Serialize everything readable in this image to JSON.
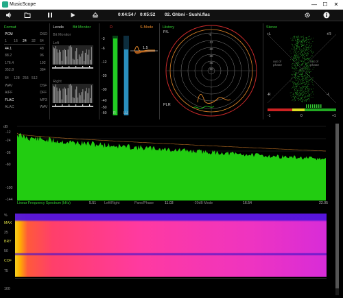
{
  "window": {
    "title": "MusicScope",
    "minimize": "—",
    "maximize": "☐",
    "close": "✕"
  },
  "toolbar": {
    "current_time": "0:04:54",
    "separator": "/",
    "total_time": "0:05:52",
    "track": "02. Ghbni - Sushi.flac"
  },
  "format": {
    "title": "Format",
    "rows": [
      [
        "PCM",
        "",
        "",
        "",
        "DSD"
      ],
      [
        "1",
        "16",
        "24",
        "32",
        "64"
      ],
      [
        "44.1",
        "",
        "",
        "",
        "48"
      ],
      [
        "88.2",
        "",
        "",
        "",
        "96"
      ],
      [
        "176.4",
        "",
        "",
        "",
        "192"
      ],
      [
        "352.8",
        "",
        "",
        "",
        "384"
      ],
      [
        "64",
        "128",
        "256",
        "512",
        ""
      ],
      [
        "WAV",
        "",
        "",
        "",
        "DSF"
      ],
      [
        "AIFF",
        "",
        "",
        "",
        "DFF"
      ],
      [
        "FLAC",
        "",
        "",
        "",
        "MP3"
      ],
      [
        "ALAC",
        "",
        "",
        "",
        "WAV"
      ]
    ]
  },
  "levels": {
    "title": "Levels",
    "bit_monitor": "Bit Monitor",
    "sub_bit_monitor": "Bit Monitor",
    "left": "Left",
    "right": "Right",
    "scale": [
      "-3",
      "-6",
      "-12",
      "-20",
      "-30",
      "-40",
      "-50",
      "-60"
    ],
    "mode_label": "S-Mode",
    "d_label": "D",
    "r_value": "1.5",
    "bar_labels": [
      "R",
      "LU"
    ]
  },
  "history": {
    "title": "History",
    "pl_label": "P/L",
    "plr_label": "PLR",
    "rings": [
      "-6",
      "-12",
      "-20",
      "-30",
      "-40",
      "-50"
    ]
  },
  "stereo": {
    "title": "Stereo",
    "plus_l": "+L",
    "plus_r": "+R",
    "minus_l": "-R",
    "minus_r": "-L",
    "out_phase_left": "out of phase",
    "out_phase_right": "out of phase",
    "corr_values": [
      "-1",
      "0",
      "+1"
    ]
  },
  "spectrum": {
    "label": "Linear Frequency Spectrum (kHz)",
    "db_label": "dB",
    "yticks": [
      "-12",
      "-24",
      "-36",
      "-60",
      "-100",
      "-144"
    ],
    "xticks": [
      "5.51",
      "11.03",
      "16.54",
      "22.05"
    ],
    "modes": [
      "Left/Right",
      "Pans/Phase",
      "-20dB Mode"
    ]
  },
  "spectrogram": {
    "yticks": [
      "%",
      "MAX",
      "25",
      "BRY",
      "50",
      "COF",
      "75",
      "100"
    ]
  },
  "colors": {
    "accent_green": "#33cc33",
    "level_blue": "#2a8fbf",
    "history_orange": "#e88a2a",
    "ring_red": "#cc2a2a",
    "spectrum_fill": "#22cc11"
  },
  "icons": [
    "volume-icon",
    "folder-icon",
    "pause-icon",
    "play-icon",
    "eject-icon",
    "gear-icon",
    "info-icon"
  ]
}
